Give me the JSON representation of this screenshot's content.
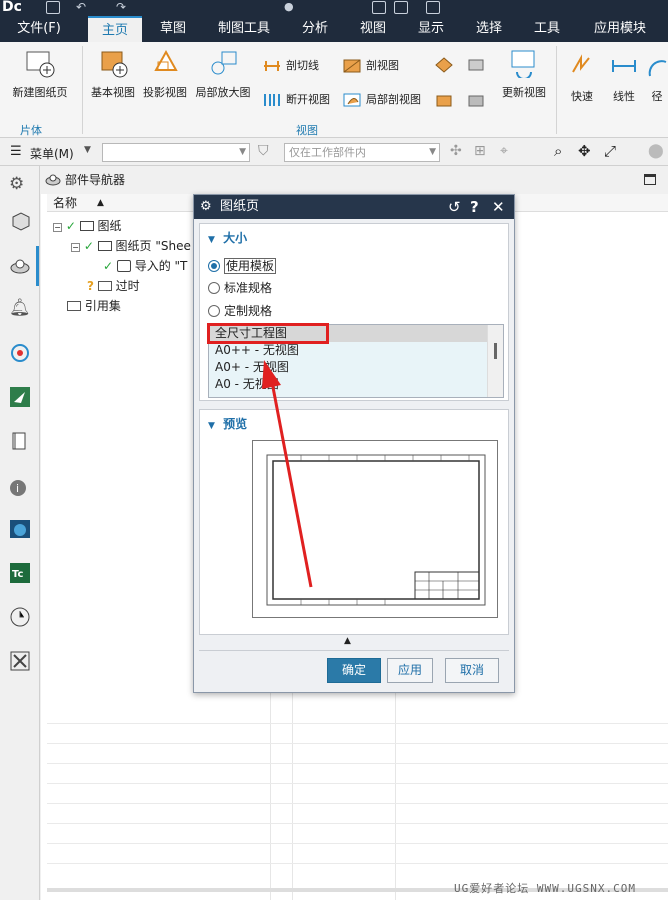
{
  "titlebar": {
    "logo": "Dc"
  },
  "menu": {
    "tabs": [
      {
        "label": "文件(F)",
        "active": false
      },
      {
        "label": "主页",
        "active": true
      },
      {
        "label": "草图",
        "active": false
      },
      {
        "label": "制图工具",
        "active": false
      },
      {
        "label": "分析",
        "active": false
      },
      {
        "label": "视图",
        "active": false
      },
      {
        "label": "显示",
        "active": false
      },
      {
        "label": "选择",
        "active": false
      },
      {
        "label": "工具",
        "active": false
      },
      {
        "label": "应用模块",
        "active": false
      }
    ]
  },
  "ribbon": {
    "new_sheet": "新建图纸页",
    "group_sheet": "片体",
    "base_view": "基本视图",
    "projected_view": "投影视图",
    "detail_view": "局部放大图",
    "section_line": "剖切线",
    "section_view": "剖视图",
    "break_view": "断开视图",
    "partial_section": "局部剖视图",
    "update_view": "更新视图",
    "group_view": "视图",
    "quick": "快速",
    "linear": "线性",
    "radial": "径"
  },
  "toolbar": {
    "menu_label": "菜单(M)",
    "filter_placeholder": "仅在工作部件内"
  },
  "navigator": {
    "title": "部件导航器",
    "col_name": "名称",
    "tree": [
      {
        "label": "图纸"
      },
      {
        "label": "图纸页 \"Shee"
      },
      {
        "label": "导入的 \"T"
      },
      {
        "label": "过时"
      },
      {
        "label": "引用集"
      }
    ]
  },
  "dialog": {
    "title": "图纸页",
    "section_size": "大小",
    "radio_template": "使用模板",
    "radio_standard": "标准规格",
    "radio_custom": "定制规格",
    "templates": [
      "全尺寸工程图",
      "A0++ - 无视图",
      "A0+ - 无视图",
      "A0 - 无视图"
    ],
    "section_preview": "预览",
    "ok": "确定",
    "apply": "应用",
    "cancel": "取消"
  },
  "watermark": "UG爱好者论坛 WWW.UGSNX.COM",
  "colors": {
    "titlebar": "#1f2b3c",
    "accent": "#1f6fa8",
    "highlight_red": "#e02020"
  }
}
